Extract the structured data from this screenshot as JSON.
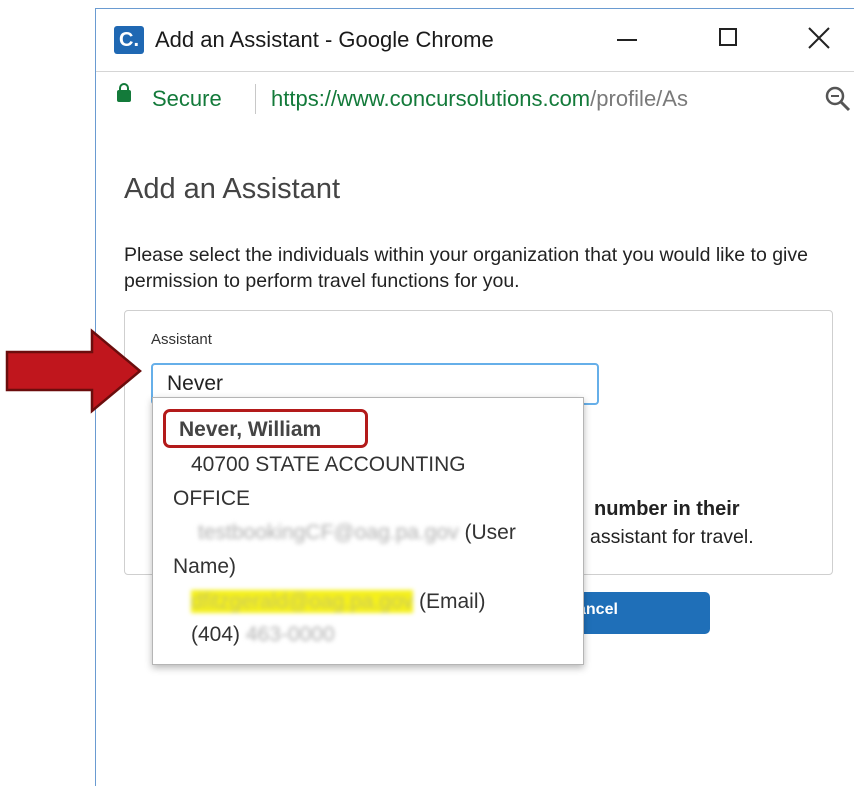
{
  "window": {
    "title": "Add an Assistant - Google Chrome",
    "app_icon": "C."
  },
  "address_bar": {
    "secure_label": "Secure",
    "url_main": "https://www.concursolutions.com",
    "url_rest": "/profile/As"
  },
  "page": {
    "title": "Add an Assistant",
    "intro": "Please select the individuals within your organization that you would like to give permission to perform travel functions for you.",
    "assistant_label": "Assistant",
    "assistant_value": "Never",
    "hint_bold": "number in their",
    "hint_normal": "assistant for travel.",
    "cancel_label": "ancel"
  },
  "dropdown": {
    "name": "Never, William",
    "dept_line1": "40700 STATE ACCOUNTING",
    "dept_line2": "OFFICE",
    "username_value": "testbookingCF@oag.pa.gov",
    "username_suffix": "(User",
    "username_suffix2": "Name)",
    "email_value": "dfitzgerald@oag.pa.gov",
    "email_suffix": "(Email)",
    "phone_prefix": "(404)",
    "phone_value": "463-0000"
  },
  "colors": {
    "accent": "#1f6fb8",
    "secure_green": "#137a3a",
    "highlight_box": "#b31a1a",
    "arrow": "#c0161d"
  }
}
